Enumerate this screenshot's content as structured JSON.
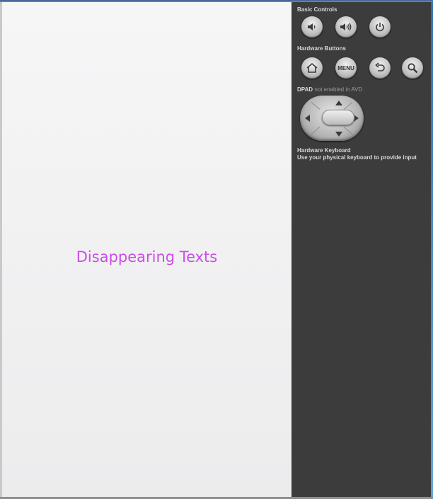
{
  "device_screen": {
    "app_text": "Disappearing Texts",
    "text_color": "#cc4de8"
  },
  "controls": {
    "basic_controls": {
      "heading": "Basic Controls",
      "buttons": [
        {
          "icon": "volume-down-icon"
        },
        {
          "icon": "volume-up-icon"
        },
        {
          "icon": "power-icon"
        }
      ]
    },
    "hardware_buttons": {
      "heading": "Hardware Buttons",
      "menu_label": "MENU",
      "buttons": [
        {
          "icon": "home-icon"
        },
        {
          "icon": "menu-button"
        },
        {
          "icon": "back-icon"
        },
        {
          "icon": "search-icon"
        }
      ]
    },
    "dpad": {
      "heading": "DPAD",
      "note": "not enabled in AVD"
    },
    "hardware_keyboard": {
      "heading": "Hardware Keyboard",
      "note": "Use your physical keyboard to provide input"
    }
  },
  "colors": {
    "panel_bg": "#3c3c3c",
    "screen_bg": "#f2f2f3",
    "window_accent": "#3a6fb0"
  }
}
